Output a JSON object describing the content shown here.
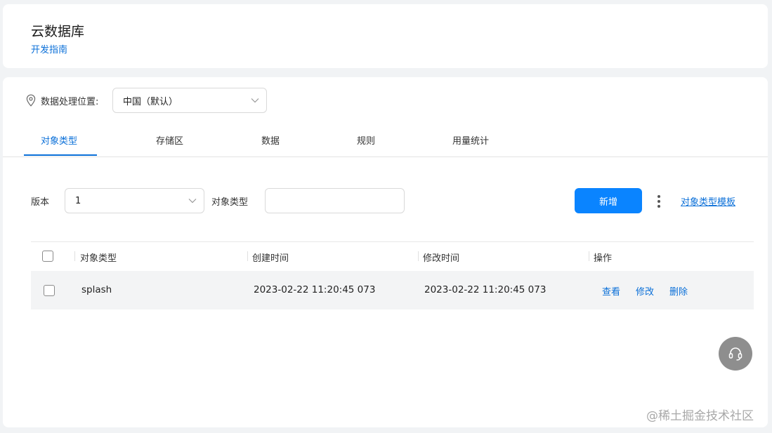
{
  "header": {
    "title": "云数据库",
    "dev_guide_link": "开发指南"
  },
  "location": {
    "label": "数据处理位置:",
    "selected": "中国（默认）"
  },
  "tabs": [
    {
      "label": "对象类型",
      "active": true
    },
    {
      "label": "存储区",
      "active": false
    },
    {
      "label": "数据",
      "active": false
    },
    {
      "label": "规则",
      "active": false
    },
    {
      "label": "用量统计",
      "active": false
    }
  ],
  "filters": {
    "version_label": "版本",
    "version_value": "1",
    "object_type_label": "对象类型",
    "object_type_value": ""
  },
  "toolbar": {
    "new_button": "新增",
    "template_link": "对象类型模板"
  },
  "table": {
    "columns": [
      "对象类型",
      "创建时间",
      "修改时间",
      "操作"
    ],
    "rows": [
      {
        "object_type": "splash",
        "created": "2023-02-22 11:20:45 073",
        "modified": "2023-02-22 11:20:45 073",
        "actions": [
          "查看",
          "修改",
          "删除"
        ]
      }
    ]
  },
  "support": {
    "icon": "headset-icon"
  },
  "watermark": "@稀土掘金技术社区",
  "colors": {
    "accent": "#0a84ff",
    "link": "#0a6fd8",
    "background": "#f1f3f5"
  }
}
